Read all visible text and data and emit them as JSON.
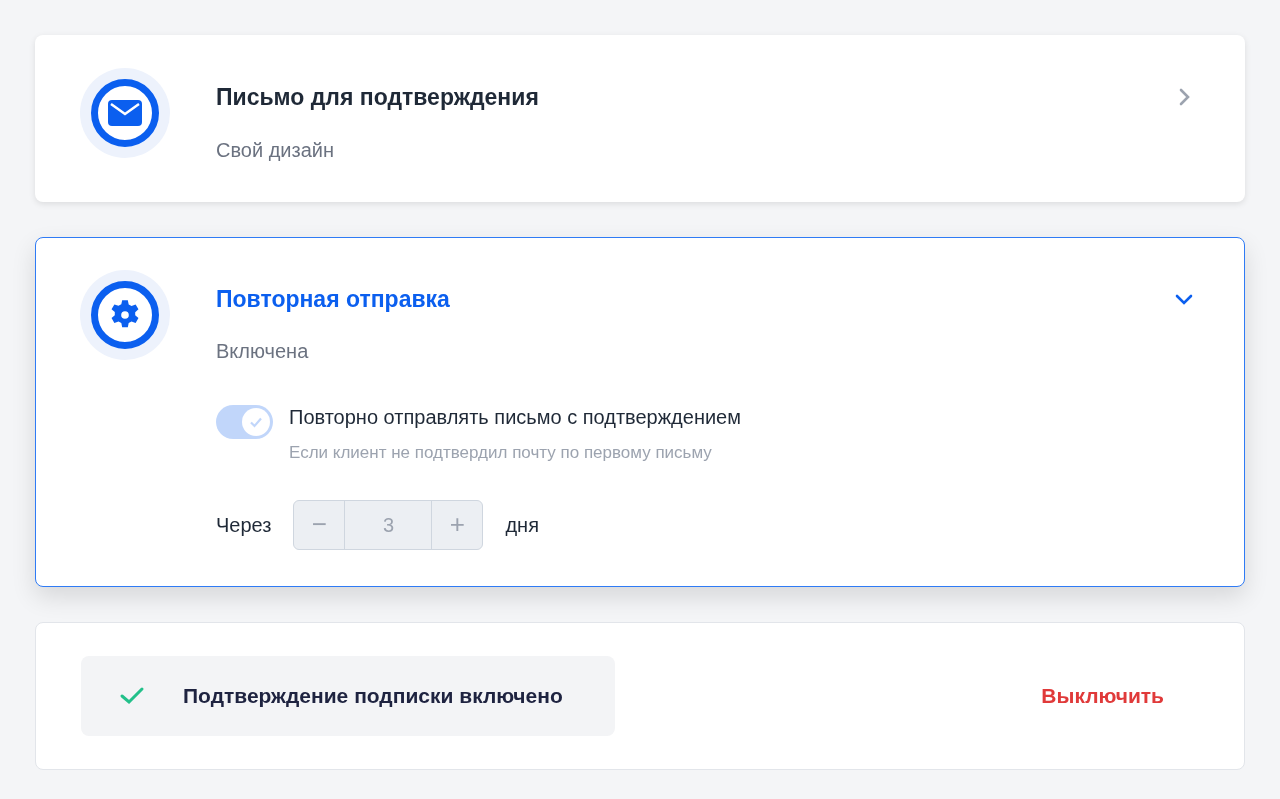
{
  "sections": [
    {
      "kind": "mail",
      "title": "Письмо для подтверждения",
      "subtitle": "Свой дизайн",
      "expanded": false
    },
    {
      "kind": "gear",
      "title": "Повторная отправка",
      "subtitle": "Включена",
      "expanded": true,
      "toggle": {
        "label": "Повторно отправлять письмо с подтверждением",
        "hint": "Если клиент не подтвердил почту по первому письму",
        "on": true,
        "disabled": true
      },
      "stepper": {
        "prefix": "Через",
        "minus": "−",
        "value": "3",
        "plus": "+",
        "suffix": "дня",
        "disabled": true
      }
    }
  ],
  "status": {
    "text": "Подтверждение подписки включено",
    "action": "Выключить"
  }
}
